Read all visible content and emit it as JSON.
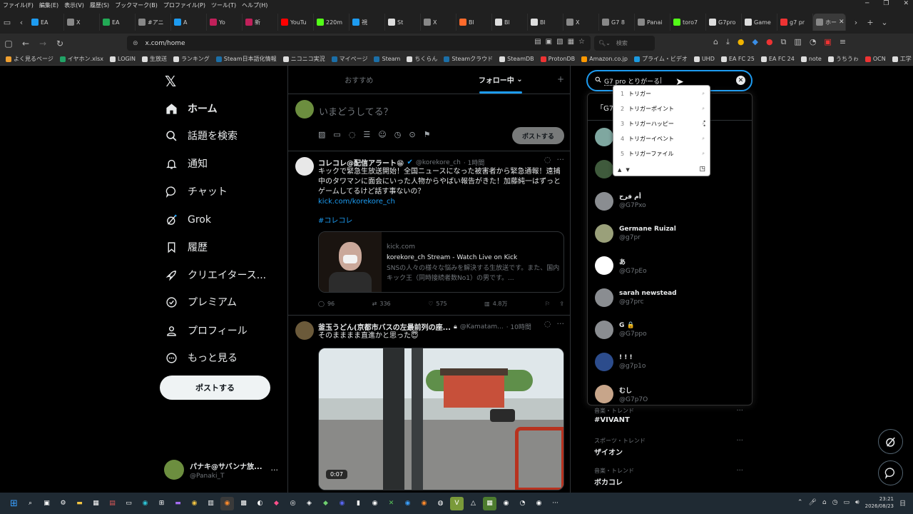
{
  "browser": {
    "menu": [
      "ファイル(F)",
      "編集(E)",
      "表示(V)",
      "履歴(S)",
      "ブックマーク(B)",
      "プロファイル(P)",
      "ツール(T)",
      "ヘルプ(H)"
    ],
    "tabs": [
      {
        "label": "EA",
        "color": "#1d9bf0"
      },
      {
        "label": "X",
        "color": "#888888"
      },
      {
        "label": "EA",
        "color": "#22aa55"
      },
      {
        "label": "#アニ",
        "color": "#888888"
      },
      {
        "label": "A",
        "color": "#1d9bf0"
      },
      {
        "label": "Yo",
        "color": "#c0205a"
      },
      {
        "label": "新",
        "color": "#c0205a"
      },
      {
        "label": "YouTu",
        "color": "#ff0000"
      },
      {
        "label": "220m",
        "color": "#53fc18"
      },
      {
        "label": "視",
        "color": "#1d9bf0"
      },
      {
        "label": "St",
        "color": "#dddddd"
      },
      {
        "label": "X",
        "color": "#888888"
      },
      {
        "label": "Bl",
        "color": "#ff6a2b"
      },
      {
        "label": "Bl",
        "color": "#dddddd"
      },
      {
        "label": "Bl",
        "color": "#dddddd"
      },
      {
        "label": "X",
        "color": "#888888"
      },
      {
        "label": "G7 8",
        "color": "#888888"
      },
      {
        "label": "Panai",
        "color": "#888888"
      },
      {
        "label": "toro7",
        "color": "#53fc18"
      },
      {
        "label": "G7pro",
        "color": "#dddddd"
      },
      {
        "label": "Game",
        "color": "#dddddd"
      },
      {
        "label": "g7 pr",
        "color": "#e33"
      },
      {
        "label": "ホー",
        "color": "#888888",
        "active": true
      }
    ],
    "url": "x.com/home",
    "search_placeholder": "検索",
    "bookmarks": [
      {
        "label": "よく見るページ",
        "color": "#f0a030"
      },
      {
        "label": "イヤホン.xlsx",
        "color": "#21a366"
      },
      {
        "label": "LOGIN",
        "color": "#dddddd"
      },
      {
        "label": "生放送",
        "color": "#dddddd"
      },
      {
        "label": "ランキング",
        "color": "#dddddd"
      },
      {
        "label": "Steam日本語化情報",
        "color": "#1b6fa8"
      },
      {
        "label": "ニコニコ実況",
        "color": "#dddddd"
      },
      {
        "label": "マイページ",
        "color": "#1b6fa8"
      },
      {
        "label": "Steam",
        "color": "#1b6fa8"
      },
      {
        "label": "ちくらん",
        "color": "#dddddd"
      },
      {
        "label": "Steamクラウド",
        "color": "#1b6fa8"
      },
      {
        "label": "SteamDB",
        "color": "#dddddd"
      },
      {
        "label": "ProtonDB",
        "color": "#e33"
      },
      {
        "label": "Amazon.co.jp",
        "color": "#f90"
      },
      {
        "label": "プライム・ビデオ",
        "color": "#1b9ae0"
      },
      {
        "label": "UHD",
        "color": "#dddddd"
      },
      {
        "label": "EA FC 25",
        "color": "#dddddd"
      },
      {
        "label": "EA FC 24",
        "color": "#dddddd"
      },
      {
        "label": "note",
        "color": "#dddddd"
      },
      {
        "label": "うちうゎ",
        "color": "#dddddd"
      },
      {
        "label": "OCN",
        "color": "#e33"
      },
      {
        "label": "工学・故進一覧 | NTT",
        "color": "#dddddd"
      }
    ]
  },
  "nav": {
    "home": "ホーム",
    "explore": "話題を検索",
    "notifications": "通知",
    "chat": "チャット",
    "grok": "Grok",
    "bookmarks": "履歴",
    "creator": "クリエイタース...",
    "premium": "プレミアム",
    "profile": "プロフィール",
    "more": "もっと見る",
    "post": "ポストする"
  },
  "account": {
    "name": "パナキ@サバンナ放...",
    "handle": "@Panaki_T"
  },
  "feed": {
    "tab_recommended": "おすすめ",
    "tab_following": "フォロー中",
    "composer_placeholder": "いまどうしてる？",
    "composer_post": "ポストする"
  },
  "tweets": [
    {
      "name": "コレコレ@配信アラート😁",
      "handle": "@korekore_ch",
      "time": "· 1時間",
      "text": "キックで緊急生放送開始！全国ニュースになった被害者から緊急通報！遠捕中のタワマンに面会にいった人物からやばい報告がきた！加藤純一はずっとゲームしてるけど話す事ないの？",
      "link": "kick.com/korekore_ch",
      "hashtag": "#コレコレ",
      "card_domain": "kick.com",
      "card_title": "korekore_ch Stream - Watch Live on Kick",
      "card_desc": "SNSの人々の様々な悩みを解決する生放送です。また、国内キック王（同時接続者数No1）の男です。...",
      "replies": "96",
      "reposts": "336",
      "likes": "575",
      "views": "4.8万"
    },
    {
      "name": "釜玉うどん(京都市バスの左最前列の座...",
      "handle": "@Kamatam...",
      "time": "· 10時間",
      "text": "そのまままま直進かと思った😇",
      "video_time": "0:07"
    }
  ],
  "search": {
    "query": "G7 pro とりがーる",
    "hint": "「G7",
    "ime_candidates": [
      "トリガー",
      "トリガーポイント",
      "トリガーハッピー",
      "トリガーイベント",
      "トリガーファイル"
    ],
    "results": [
      {
        "name": "",
        "handle": "",
        "color": "#7fa7a0"
      },
      {
        "name": "",
        "handle": "",
        "color": "#3f5a3c"
      },
      {
        "name": "أم فرح",
        "handle": "@G7Pxo",
        "color": "#8a8d91"
      },
      {
        "name": "Germane Ruizal",
        "handle": "@g7pr",
        "color": "#9aa07a"
      },
      {
        "name": "あ",
        "handle": "@G7pEo",
        "color": "#ffffff"
      },
      {
        "name": "sarah newstead",
        "handle": "@g7prc",
        "color": "#8a8d91"
      },
      {
        "name": "G 🔒",
        "handle": "@G7ppo",
        "color": "#8a8d91"
      },
      {
        "name": "! ! !",
        "handle": "@g7p1o",
        "color": "#2c4c8c"
      },
      {
        "name": "むし",
        "handle": "@G7p7O",
        "color": "#c7a58a"
      }
    ]
  },
  "trends": [
    {
      "category": "音楽・トレンド",
      "name": "#VIVANT"
    },
    {
      "category": "スポーツ・トレンド",
      "name": "ザイオン"
    },
    {
      "category": "音楽・トレンド",
      "name": "ボカコレ"
    }
  ],
  "taskbar": {
    "time": "23:21",
    "date": "2026/08/23",
    "lang": "日"
  }
}
